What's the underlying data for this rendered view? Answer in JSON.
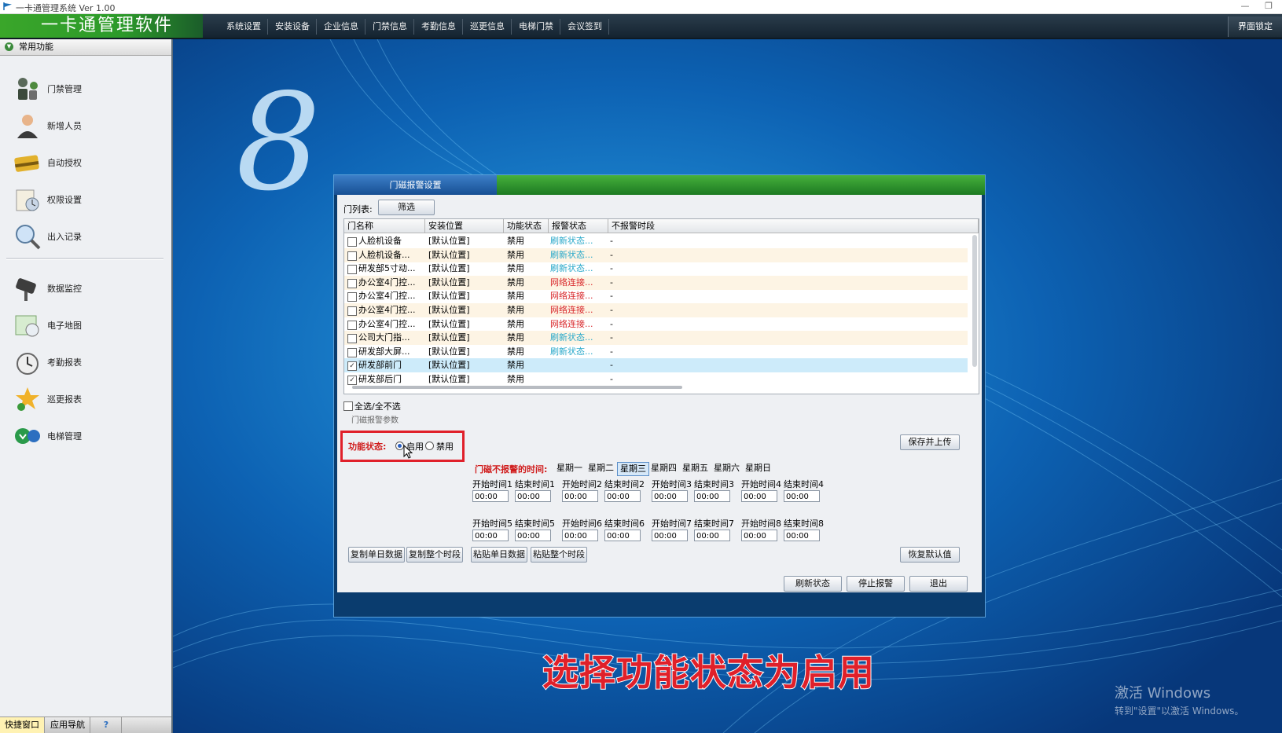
{
  "window": {
    "title": "一卡通管理系统  Ver 1.00",
    "minimize": "—",
    "restore": "❐"
  },
  "menubar": {
    "brand": "一卡通管理软件",
    "items": [
      "系统设置",
      "安装设备",
      "企业信息",
      "门禁信息",
      "考勤信息",
      "巡更信息",
      "电梯门禁",
      "会议签到"
    ],
    "lock": "界面锁定"
  },
  "sidebar": {
    "header": "常用功能",
    "collapse_glyph": "▼",
    "items": [
      {
        "label": "门禁管理",
        "icon": "door-access-icon"
      },
      {
        "label": "新增人员",
        "icon": "user-add-icon"
      },
      {
        "label": "自动授权",
        "icon": "auto-auth-icon"
      },
      {
        "label": "权限设置",
        "icon": "permission-icon"
      },
      {
        "label": "出入记录",
        "icon": "records-search-icon"
      },
      {
        "label": "数据监控",
        "icon": "camera-monitor-icon"
      },
      {
        "label": "电子地图",
        "icon": "map-icon"
      },
      {
        "label": "考勤报表",
        "icon": "clock-report-icon"
      },
      {
        "label": "巡更报表",
        "icon": "patrol-report-icon"
      },
      {
        "label": "电梯管理",
        "icon": "elevator-icon"
      }
    ],
    "footer": {
      "tabs": [
        "快捷窗口",
        "应用导航"
      ],
      "help": "?"
    }
  },
  "dialog": {
    "title": "门磁报警设置",
    "list_label": "门列表:",
    "filter_button": "筛选",
    "columns": [
      "门名称",
      "安装位置",
      "功能状态",
      "报警状态",
      "不报警时段"
    ],
    "rows": [
      {
        "checked": false,
        "name": "人脸机设备",
        "location": "[默认位置]",
        "status": "禁用",
        "alarm": "刷新状态...",
        "alarm_type": "refresh",
        "period": "-"
      },
      {
        "checked": false,
        "name": "人脸机设备...",
        "location": "[默认位置]",
        "status": "禁用",
        "alarm": "刷新状态...",
        "alarm_type": "refresh",
        "period": "-"
      },
      {
        "checked": false,
        "name": "研发部5寸动...",
        "location": "[默认位置]",
        "status": "禁用",
        "alarm": "刷新状态...",
        "alarm_type": "refresh",
        "period": "-"
      },
      {
        "checked": false,
        "name": "办公室4门控...",
        "location": "[默认位置]",
        "status": "禁用",
        "alarm": "网络连接...",
        "alarm_type": "net",
        "period": "-"
      },
      {
        "checked": false,
        "name": "办公室4门控...",
        "location": "[默认位置]",
        "status": "禁用",
        "alarm": "网络连接...",
        "alarm_type": "net",
        "period": "-"
      },
      {
        "checked": false,
        "name": "办公室4门控...",
        "location": "[默认位置]",
        "status": "禁用",
        "alarm": "网络连接...",
        "alarm_type": "net",
        "period": "-"
      },
      {
        "checked": false,
        "name": "办公室4门控...",
        "location": "[默认位置]",
        "status": "禁用",
        "alarm": "网络连接...",
        "alarm_type": "net",
        "period": "-"
      },
      {
        "checked": false,
        "name": "公司大门指...",
        "location": "[默认位置]",
        "status": "禁用",
        "alarm": "刷新状态...",
        "alarm_type": "refresh",
        "period": "-"
      },
      {
        "checked": false,
        "name": "研发部大屏...",
        "location": "[默认位置]",
        "status": "禁用",
        "alarm": "刷新状态...",
        "alarm_type": "refresh",
        "period": "-"
      },
      {
        "checked": true,
        "name": "研发部前门",
        "location": "[默认位置]",
        "status": "禁用",
        "alarm": "",
        "alarm_type": "none",
        "period": "-",
        "selected": true
      },
      {
        "checked": true,
        "name": "研发部后门",
        "location": "[默认位置]",
        "status": "禁用",
        "alarm": "",
        "alarm_type": "none",
        "period": "-"
      }
    ],
    "select_all": "全选/全不选",
    "params_label": "门磁报警参数",
    "function_status_label": "功能状态:",
    "radio_enable": "启用",
    "radio_disable": "禁用",
    "enabled": true,
    "save_upload": "保存并上传",
    "no_alarm_label": "门磁不报警的时间:",
    "days": [
      "星期一",
      "星期二",
      "星期三",
      "星期四",
      "星期五",
      "星期六",
      "星期日"
    ],
    "active_day": 2,
    "time_slots": [
      {
        "start": "开始时间1",
        "end": "结束时间1",
        "start_value": "00:00",
        "end_value": "00:00"
      },
      {
        "start": "开始时间2",
        "end": "结束时间2",
        "start_value": "00:00",
        "end_value": "00:00"
      },
      {
        "start": "开始时间3",
        "end": "结束时间3",
        "start_value": "00:00",
        "end_value": "00:00"
      },
      {
        "start": "开始时间4",
        "end": "结束时间4",
        "start_value": "00:00",
        "end_value": "00:00"
      },
      {
        "start": "开始时间5",
        "end": "结束时间5",
        "start_value": "00:00",
        "end_value": "00:00"
      },
      {
        "start": "开始时间6",
        "end": "结束时间6",
        "start_value": "00:00",
        "end_value": "00:00"
      },
      {
        "start": "开始时间7",
        "end": "结束时间7",
        "start_value": "00:00",
        "end_value": "00:00"
      },
      {
        "start": "开始时间8",
        "end": "结束时间8",
        "start_value": "00:00",
        "end_value": "00:00"
      }
    ],
    "copy_day": "复制单日数据",
    "copy_all": "复制整个时段",
    "paste_day": "粘贴单日数据",
    "paste_all": "粘贴整个时段",
    "restore_default": "恢复默认值",
    "refresh_status": "刷新状态",
    "stop_alarm": "停止报警",
    "exit": "退出"
  },
  "caption": "选择功能状态为启用",
  "watermark": {
    "line1": "激活 Windows",
    "line2": "转到\"设置\"以激活 Windows。"
  },
  "colors": {
    "desktop": "#0a4f9c",
    "brand_green": "#3aa62a",
    "alarm_refresh": "#27a7c9",
    "alarm_network": "#d8262a",
    "highlight_red": "#e0202a"
  }
}
